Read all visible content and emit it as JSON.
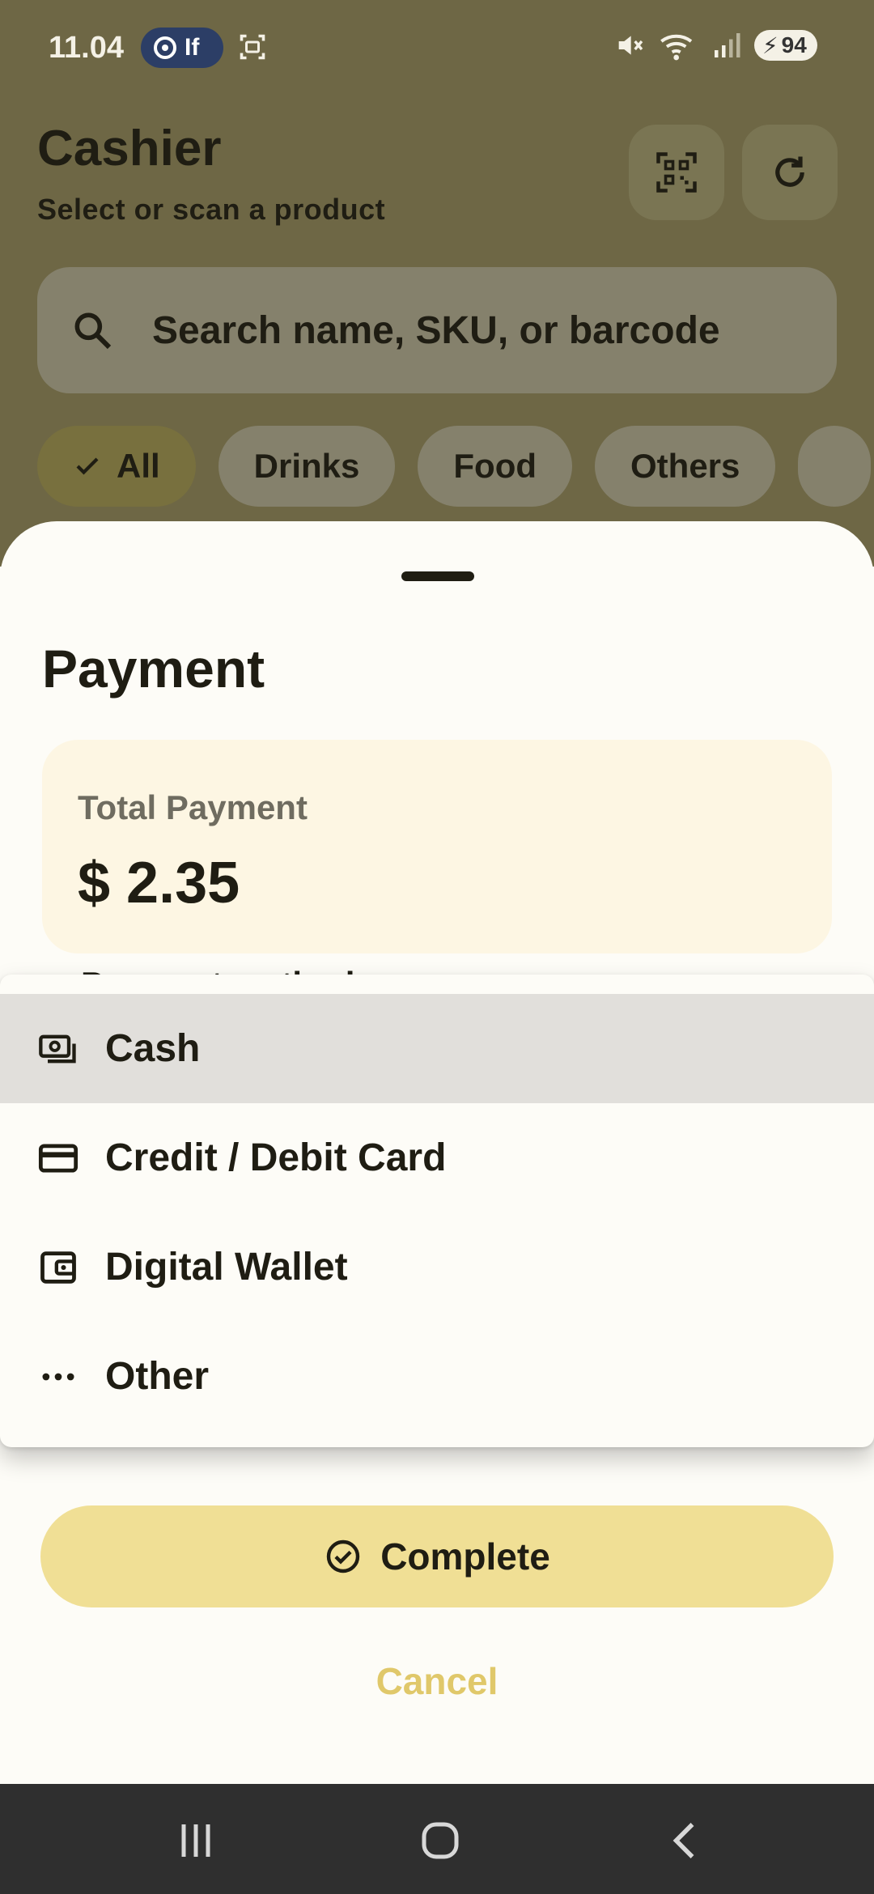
{
  "status_bar": {
    "time": "11.04",
    "pill_label": "If",
    "battery": "94"
  },
  "header": {
    "title": "Cashier",
    "subtitle": "Select or scan a product"
  },
  "search": {
    "placeholder": "Search name, SKU, or barcode"
  },
  "categories": [
    "All",
    "Drinks",
    "Food",
    "Others"
  ],
  "payment_sheet": {
    "title": "Payment",
    "total_label": "Total Payment",
    "total_value": "$ 2.35",
    "method_label_partial": "Payment method"
  },
  "payment_methods": [
    {
      "label": "Cash",
      "icon": "cash-icon",
      "highlighted": true
    },
    {
      "label": "Credit / Debit Card",
      "icon": "card-icon",
      "highlighted": false
    },
    {
      "label": "Digital Wallet",
      "icon": "wallet-icon",
      "highlighted": false
    },
    {
      "label": "Other",
      "icon": "more-horiz-icon",
      "highlighted": false
    }
  ],
  "actions": {
    "complete_label": "Complete",
    "cancel_label": "Cancel"
  },
  "colors": {
    "accent": "#f0df95",
    "cancel_text": "#e0c86a",
    "highlight_row": "#e1dfdb"
  }
}
